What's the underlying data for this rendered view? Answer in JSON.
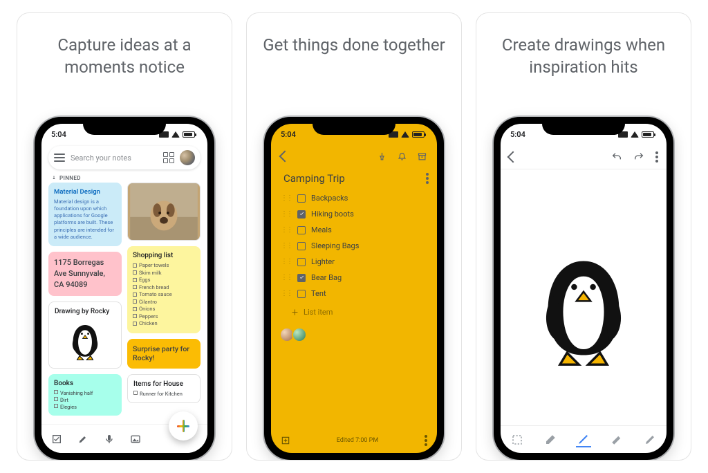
{
  "cards": [
    {
      "headline": "Capture ideas at a moments notice"
    },
    {
      "headline": "Get things done together"
    },
    {
      "headline": "Create drawings when inspiration hits"
    }
  ],
  "status_time": "5:04",
  "card1": {
    "search_placeholder": "Search your notes",
    "pinned_label": "PINNED",
    "notes": {
      "material": {
        "title": "Material Design",
        "body": "Material design is a foundation upon which applications for Google platforms are built. These principles are intended for a wide audience."
      },
      "address": "1175 Borregas Ave Sunnyvale, CA 94089",
      "drawing_title": "Drawing by Rocky",
      "books": {
        "title": "Books",
        "items": [
          "Vanishing half",
          "Dirt",
          "Elegies"
        ]
      },
      "shopping": {
        "title": "Shopping list",
        "items": [
          "Paper towels",
          "Skim milk",
          "Eggs",
          "French bread",
          "Tomato sauce",
          "Cilantro",
          "Onions",
          "Peppers",
          "Chicken"
        ]
      },
      "party": "Surprise party for Rocky!",
      "items_house": {
        "title": "Items for House",
        "items": [
          "Runner for Kitchen"
        ]
      }
    }
  },
  "card2": {
    "title": "Camping Trip",
    "items": [
      {
        "label": "Backpacks",
        "checked": false
      },
      {
        "label": "Hiking boots",
        "checked": true
      },
      {
        "label": "Meals",
        "checked": false
      },
      {
        "label": "Sleeping Bags",
        "checked": false
      },
      {
        "label": "Lighter",
        "checked": false
      },
      {
        "label": "Bear Bag",
        "checked": true
      },
      {
        "label": "Tent",
        "checked": false
      }
    ],
    "add_item_label": "List item",
    "edited_label": "Edited 7:00 PM"
  }
}
